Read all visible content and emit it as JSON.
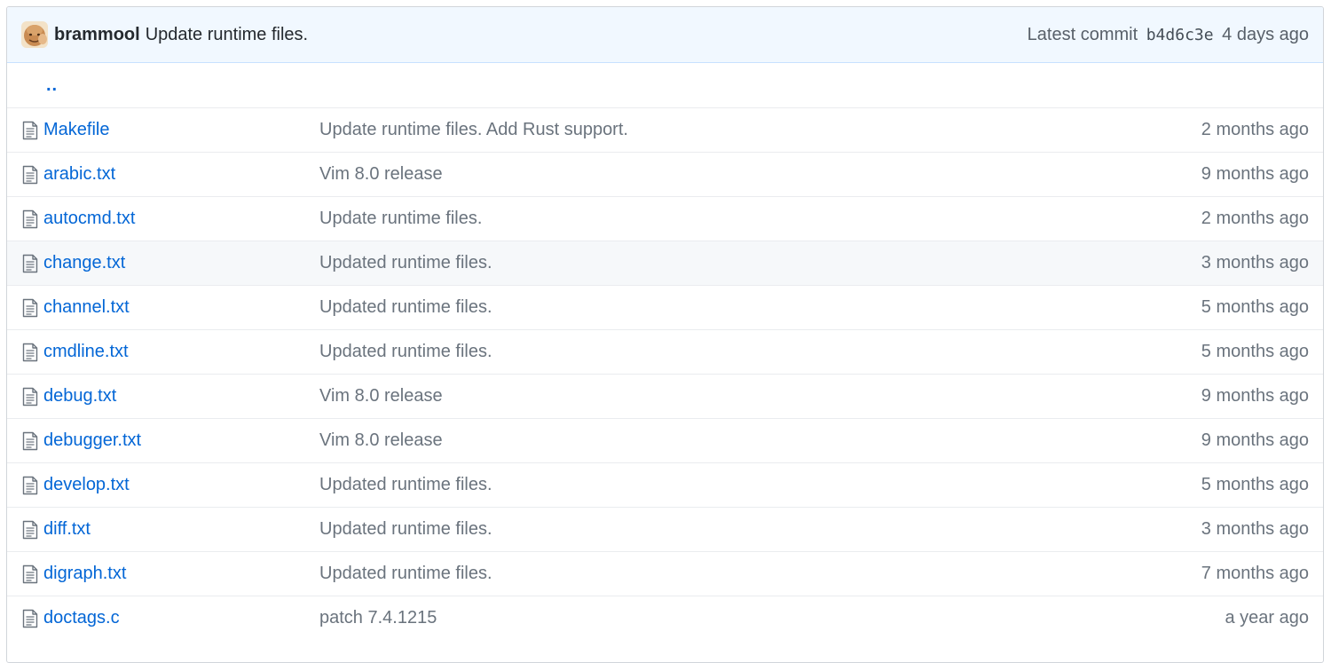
{
  "commit": {
    "author": "brammool",
    "message": "Update runtime files.",
    "latest_label": "Latest commit",
    "sha": "b4d6c3e",
    "age": "4 days ago"
  },
  "parent_dir": "..",
  "colors": {
    "link": "#0366d6",
    "muted": "#6a737d",
    "header_bg": "#f1f8ff",
    "row_hover_bg": "#f6f8fa"
  },
  "files": [
    {
      "icon": "file-icon",
      "name": "Makefile",
      "message": "Update runtime files. Add Rust support.",
      "age": "2 months ago"
    },
    {
      "icon": "file-icon",
      "name": "arabic.txt",
      "message": "Vim 8.0 release",
      "age": "9 months ago"
    },
    {
      "icon": "file-icon",
      "name": "autocmd.txt",
      "message": "Update runtime files.",
      "age": "2 months ago"
    },
    {
      "icon": "file-icon",
      "name": "change.txt",
      "message": "Updated runtime files.",
      "age": "3 months ago"
    },
    {
      "icon": "file-icon",
      "name": "channel.txt",
      "message": "Updated runtime files.",
      "age": "5 months ago"
    },
    {
      "icon": "file-icon",
      "name": "cmdline.txt",
      "message": "Updated runtime files.",
      "age": "5 months ago"
    },
    {
      "icon": "file-icon",
      "name": "debug.txt",
      "message": "Vim 8.0 release",
      "age": "9 months ago"
    },
    {
      "icon": "file-icon",
      "name": "debugger.txt",
      "message": "Vim 8.0 release",
      "age": "9 months ago"
    },
    {
      "icon": "file-icon",
      "name": "develop.txt",
      "message": "Updated runtime files.",
      "age": "5 months ago"
    },
    {
      "icon": "file-icon",
      "name": "diff.txt",
      "message": "Updated runtime files.",
      "age": "3 months ago"
    },
    {
      "icon": "file-icon",
      "name": "digraph.txt",
      "message": "Updated runtime files.",
      "age": "7 months ago"
    },
    {
      "icon": "file-icon",
      "name": "doctags.c",
      "message": "patch 7.4.1215",
      "age": "a year ago"
    }
  ]
}
